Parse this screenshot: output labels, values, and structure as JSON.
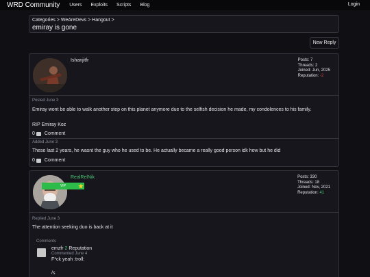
{
  "nav": {
    "brand": "WRD Community",
    "links": [
      "Users",
      "Exploits",
      "Scripts",
      "Blog"
    ],
    "login": "Login"
  },
  "thread": {
    "breadcrumb": [
      "Categories >",
      "WeAreDevs >",
      "Hangout >"
    ],
    "title": "emiray is gone",
    "new_reply": "New Reply"
  },
  "posts": [
    {
      "username": "Ishanjitfr",
      "stats": {
        "posts": "Posts: 7",
        "threads": "Threads: 2",
        "joined": "Joined: Jun, 2025",
        "reputation_label": "Reputation:",
        "reputation_value": "-2"
      },
      "posted": "Posted June 3",
      "body": "Emiray wont be able to walk another step on this planet anymore due to the selfish decision he made, my condolences to his family.",
      "body2": "RIP Emiray Koz",
      "likes": "0",
      "comment_label": "Comment",
      "added": "Added June 3",
      "added_body": "These last 2 years, he wasnt the guy who he used to be. He actually became a really good person idk how but he did",
      "added_likes": "0",
      "added_comment_label": "Comment"
    },
    {
      "username": "RealRelNik",
      "badge": "VIP",
      "stats": {
        "posts": "Posts: 330",
        "threads": "Threads: 18",
        "joined": "Joined: Nov, 2021",
        "reputation_label": "Reputation:",
        "reputation_value": "41"
      },
      "replied": "Replied June 3",
      "body": "The attention seeking duo is back at it",
      "comments_heading": "Comments",
      "comment": {
        "author": "emzfr",
        "reputation": "2",
        "reputation_label": "Reputation",
        "date": "Commented June 4",
        "text": "F*ck yeah :troll:",
        "text2": "/s"
      }
    }
  ],
  "colors": {
    "accent_green": "#4ac477",
    "negative_red": "#d24a4a",
    "vip_green": "#2dbb4a",
    "star": "#f2d230"
  }
}
